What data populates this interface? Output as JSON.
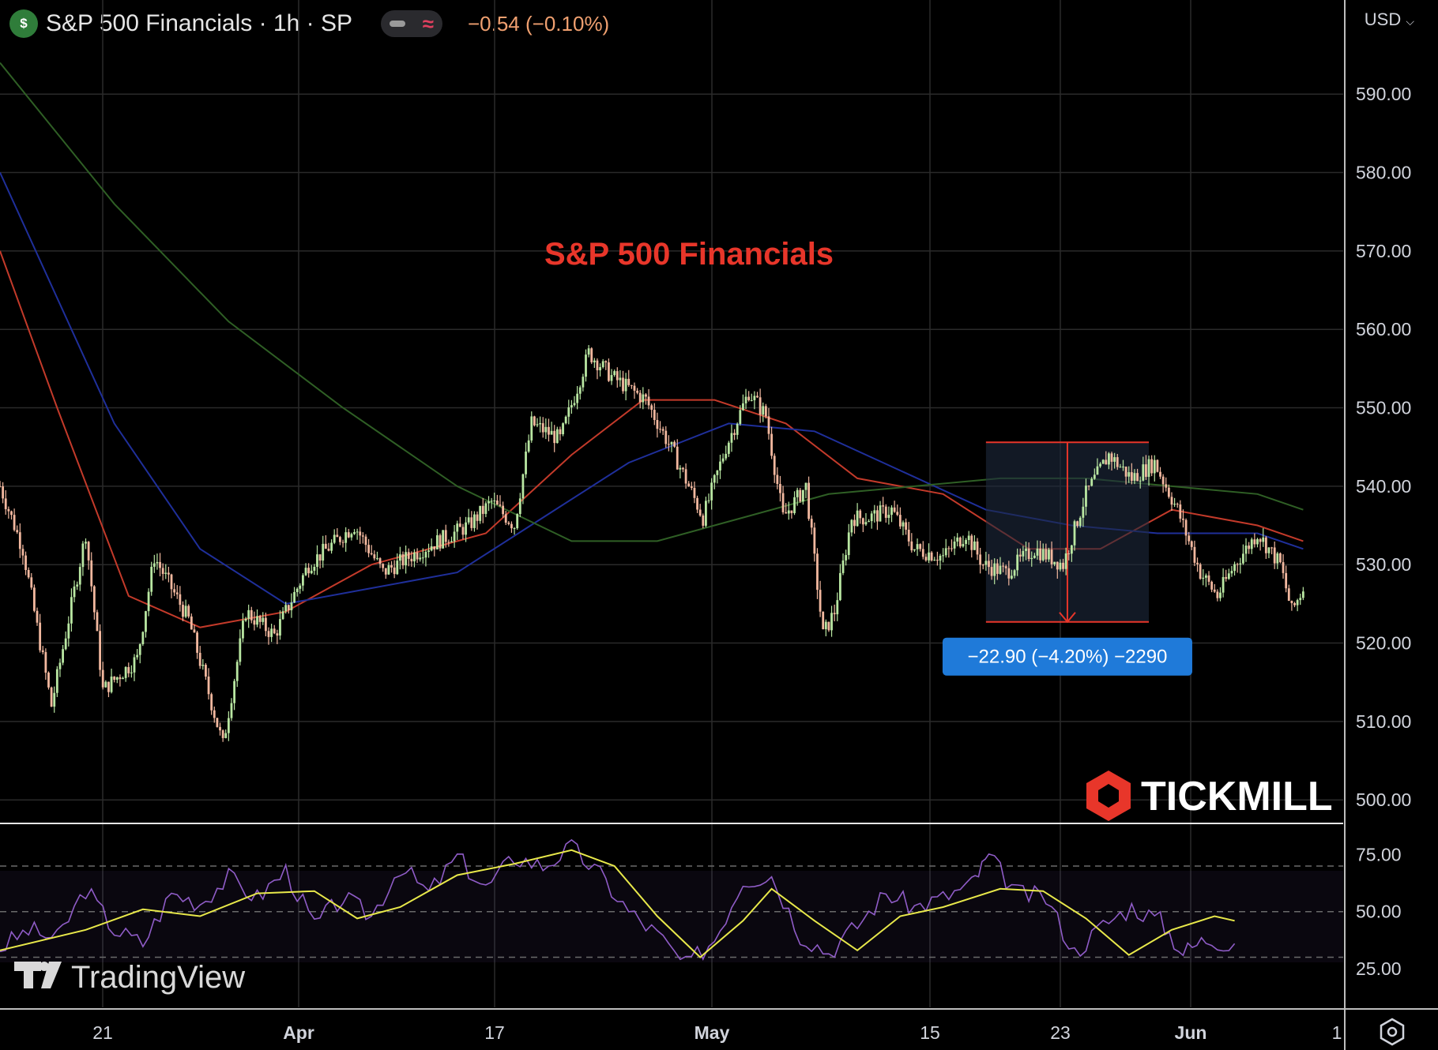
{
  "header": {
    "symbol_icon": "currency-coin-icon",
    "title": "S&P 500 Financials · 1h · SP",
    "indicator_pill_icons": [
      "minus-icon",
      "approx-wave-icon"
    ],
    "change": "−0.54 (−0.10%)",
    "currency": "USD"
  },
  "colors": {
    "background": "#000000",
    "grid": "#2a2a2a",
    "candle_up": "#b9e7a2",
    "candle_down": "#f2b89f",
    "ma_red": "#c33a2a",
    "ma_blue": "#1f2f9a",
    "ma_green": "#2f5f25",
    "rsi": "#8f5cc7",
    "rsi_ma": "#e8e84a",
    "annotation": "#e8362a",
    "measure_box": "#1f7ad9"
  },
  "chart_data": [
    {
      "type": "line",
      "subtype": "candlestick",
      "title": "S&P 500 Financials",
      "xlabel": "",
      "ylabel": "",
      "x_ticks": [
        "21",
        "Apr",
        "17",
        "May",
        "15",
        "23",
        "Jun",
        "1"
      ],
      "y_ticks": [
        "500.00",
        "510.00",
        "520.00",
        "530.00",
        "540.00",
        "550.00",
        "560.00",
        "570.00",
        "580.00",
        "590.00"
      ],
      "ylim": [
        497,
        602
      ],
      "grid": true,
      "price_path": [
        {
          "x": 0,
          "y": 540
        },
        {
          "x": 8,
          "y": 532
        },
        {
          "x": 18,
          "y": 512
        },
        {
          "x": 30,
          "y": 534
        },
        {
          "x": 36,
          "y": 514
        },
        {
          "x": 48,
          "y": 518
        },
        {
          "x": 54,
          "y": 531
        },
        {
          "x": 66,
          "y": 523
        },
        {
          "x": 78,
          "y": 507
        },
        {
          "x": 86,
          "y": 524
        },
        {
          "x": 96,
          "y": 521
        },
        {
          "x": 108,
          "y": 530
        },
        {
          "x": 124,
          "y": 535
        },
        {
          "x": 134,
          "y": 529
        },
        {
          "x": 148,
          "y": 532
        },
        {
          "x": 164,
          "y": 535
        },
        {
          "x": 172,
          "y": 538
        },
        {
          "x": 180,
          "y": 535
        },
        {
          "x": 186,
          "y": 548
        },
        {
          "x": 196,
          "y": 546
        },
        {
          "x": 206,
          "y": 557
        },
        {
          "x": 214,
          "y": 554
        },
        {
          "x": 226,
          "y": 551
        },
        {
          "x": 236,
          "y": 544
        },
        {
          "x": 246,
          "y": 536
        },
        {
          "x": 254,
          "y": 545
        },
        {
          "x": 262,
          "y": 552
        },
        {
          "x": 268,
          "y": 549
        },
        {
          "x": 274,
          "y": 536
        },
        {
          "x": 282,
          "y": 540
        },
        {
          "x": 288,
          "y": 521
        },
        {
          "x": 292,
          "y": 524
        },
        {
          "x": 298,
          "y": 536
        },
        {
          "x": 304,
          "y": 536
        },
        {
          "x": 312,
          "y": 537
        },
        {
          "x": 320,
          "y": 532
        },
        {
          "x": 330,
          "y": 531
        },
        {
          "x": 338,
          "y": 534
        },
        {
          "x": 344,
          "y": 530
        },
        {
          "x": 352,
          "y": 529
        },
        {
          "x": 362,
          "y": 532
        },
        {
          "x": 372,
          "y": 530
        },
        {
          "x": 380,
          "y": 539
        },
        {
          "x": 388,
          "y": 544
        },
        {
          "x": 396,
          "y": 541
        },
        {
          "x": 404,
          "y": 543
        },
        {
          "x": 412,
          "y": 537
        },
        {
          "x": 420,
          "y": 529
        },
        {
          "x": 426,
          "y": 526
        },
        {
          "x": 432,
          "y": 530
        },
        {
          "x": 440,
          "y": 534
        },
        {
          "x": 448,
          "y": 530
        },
        {
          "x": 452,
          "y": 524
        },
        {
          "x": 456,
          "y": 527
        }
      ],
      "x_span": [
        0,
        470
      ],
      "moving_averages": [
        {
          "color_key": "ma_red",
          "values": [
            {
              "x": 0,
              "y": 570
            },
            {
              "x": 20,
              "y": 550
            },
            {
              "x": 45,
              "y": 526
            },
            {
              "x": 70,
              "y": 522
            },
            {
              "x": 100,
              "y": 524
            },
            {
              "x": 130,
              "y": 530
            },
            {
              "x": 170,
              "y": 534
            },
            {
              "x": 200,
              "y": 544
            },
            {
              "x": 225,
              "y": 551
            },
            {
              "x": 250,
              "y": 551
            },
            {
              "x": 275,
              "y": 548
            },
            {
              "x": 300,
              "y": 541
            },
            {
              "x": 330,
              "y": 539
            },
            {
              "x": 360,
              "y": 532
            },
            {
              "x": 385,
              "y": 532
            },
            {
              "x": 410,
              "y": 537
            },
            {
              "x": 440,
              "y": 535
            },
            {
              "x": 456,
              "y": 533
            }
          ]
        },
        {
          "color_key": "ma_blue",
          "values": [
            {
              "x": 0,
              "y": 580
            },
            {
              "x": 40,
              "y": 548
            },
            {
              "x": 70,
              "y": 532
            },
            {
              "x": 100,
              "y": 525
            },
            {
              "x": 130,
              "y": 527
            },
            {
              "x": 160,
              "y": 529
            },
            {
              "x": 190,
              "y": 536
            },
            {
              "x": 220,
              "y": 543
            },
            {
              "x": 255,
              "y": 548
            },
            {
              "x": 285,
              "y": 547
            },
            {
              "x": 315,
              "y": 542
            },
            {
              "x": 345,
              "y": 537
            },
            {
              "x": 375,
              "y": 535
            },
            {
              "x": 405,
              "y": 534
            },
            {
              "x": 440,
              "y": 534
            },
            {
              "x": 456,
              "y": 532
            }
          ]
        },
        {
          "color_key": "ma_green",
          "values": [
            {
              "x": 0,
              "y": 594
            },
            {
              "x": 40,
              "y": 576
            },
            {
              "x": 80,
              "y": 561
            },
            {
              "x": 120,
              "y": 550
            },
            {
              "x": 160,
              "y": 540
            },
            {
              "x": 200,
              "y": 533
            },
            {
              "x": 230,
              "y": 533
            },
            {
              "x": 260,
              "y": 536
            },
            {
              "x": 290,
              "y": 539
            },
            {
              "x": 320,
              "y": 540
            },
            {
              "x": 350,
              "y": 541
            },
            {
              "x": 380,
              "y": 541
            },
            {
              "x": 410,
              "y": 540
            },
            {
              "x": 440,
              "y": 539
            },
            {
              "x": 456,
              "y": 537
            }
          ]
        }
      ],
      "measure": {
        "from_x": 345,
        "to_x": 402,
        "top": 545.6,
        "bottom": 522.7,
        "label": "−22.90 (−4.20%) −2290"
      }
    },
    {
      "type": "line",
      "subtype": "rsi",
      "title": "",
      "xlabel": "",
      "ylabel": "",
      "y_ticks": [
        "25.00",
        "50.00",
        "75.00"
      ],
      "ylim": [
        8,
        88
      ],
      "band": [
        30,
        70
      ],
      "mid": 50,
      "rsi_path": [
        {
          "x": 0,
          "y": 34
        },
        {
          "x": 10,
          "y": 42
        },
        {
          "x": 20,
          "y": 38
        },
        {
          "x": 30,
          "y": 60
        },
        {
          "x": 40,
          "y": 42
        },
        {
          "x": 50,
          "y": 36
        },
        {
          "x": 60,
          "y": 58
        },
        {
          "x": 70,
          "y": 54
        },
        {
          "x": 80,
          "y": 65
        },
        {
          "x": 90,
          "y": 56
        },
        {
          "x": 100,
          "y": 68
        },
        {
          "x": 110,
          "y": 44
        },
        {
          "x": 120,
          "y": 56
        },
        {
          "x": 130,
          "y": 48
        },
        {
          "x": 140,
          "y": 70
        },
        {
          "x": 150,
          "y": 58
        },
        {
          "x": 160,
          "y": 74
        },
        {
          "x": 170,
          "y": 60
        },
        {
          "x": 180,
          "y": 74
        },
        {
          "x": 190,
          "y": 70
        },
        {
          "x": 200,
          "y": 78
        },
        {
          "x": 210,
          "y": 66
        },
        {
          "x": 220,
          "y": 50
        },
        {
          "x": 230,
          "y": 40
        },
        {
          "x": 240,
          "y": 26
        },
        {
          "x": 250,
          "y": 38
        },
        {
          "x": 260,
          "y": 64
        },
        {
          "x": 270,
          "y": 66
        },
        {
          "x": 280,
          "y": 40
        },
        {
          "x": 290,
          "y": 32
        },
        {
          "x": 300,
          "y": 44
        },
        {
          "x": 310,
          "y": 58
        },
        {
          "x": 320,
          "y": 52
        },
        {
          "x": 330,
          "y": 56
        },
        {
          "x": 340,
          "y": 62
        },
        {
          "x": 346,
          "y": 74
        },
        {
          "x": 356,
          "y": 58
        },
        {
          "x": 366,
          "y": 56
        },
        {
          "x": 376,
          "y": 32
        },
        {
          "x": 386,
          "y": 44
        },
        {
          "x": 396,
          "y": 52
        },
        {
          "x": 406,
          "y": 46
        },
        {
          "x": 414,
          "y": 32
        },
        {
          "x": 422,
          "y": 38
        },
        {
          "x": 432,
          "y": 36
        }
      ],
      "rsi_ma_path": [
        {
          "x": 0,
          "y": 33
        },
        {
          "x": 30,
          "y": 42
        },
        {
          "x": 50,
          "y": 51
        },
        {
          "x": 70,
          "y": 48
        },
        {
          "x": 90,
          "y": 58
        },
        {
          "x": 110,
          "y": 59
        },
        {
          "x": 125,
          "y": 47
        },
        {
          "x": 140,
          "y": 52
        },
        {
          "x": 160,
          "y": 66
        },
        {
          "x": 180,
          "y": 71
        },
        {
          "x": 200,
          "y": 77
        },
        {
          "x": 215,
          "y": 70
        },
        {
          "x": 230,
          "y": 48
        },
        {
          "x": 245,
          "y": 30
        },
        {
          "x": 260,
          "y": 46
        },
        {
          "x": 270,
          "y": 60
        },
        {
          "x": 285,
          "y": 46
        },
        {
          "x": 300,
          "y": 33
        },
        {
          "x": 315,
          "y": 48
        },
        {
          "x": 330,
          "y": 52
        },
        {
          "x": 350,
          "y": 60
        },
        {
          "x": 365,
          "y": 59
        },
        {
          "x": 380,
          "y": 47
        },
        {
          "x": 395,
          "y": 31
        },
        {
          "x": 410,
          "y": 42
        },
        {
          "x": 425,
          "y": 48
        },
        {
          "x": 432,
          "y": 46
        }
      ]
    }
  ],
  "watermarks": {
    "broker_logo_icon": "tickmill-hexagon-icon",
    "broker": "TICKMILL",
    "platform_logo_icon": "tradingview-icon",
    "platform": "TradingView"
  },
  "axis_controls": {
    "settings_icon": "settings-gear-icon"
  }
}
